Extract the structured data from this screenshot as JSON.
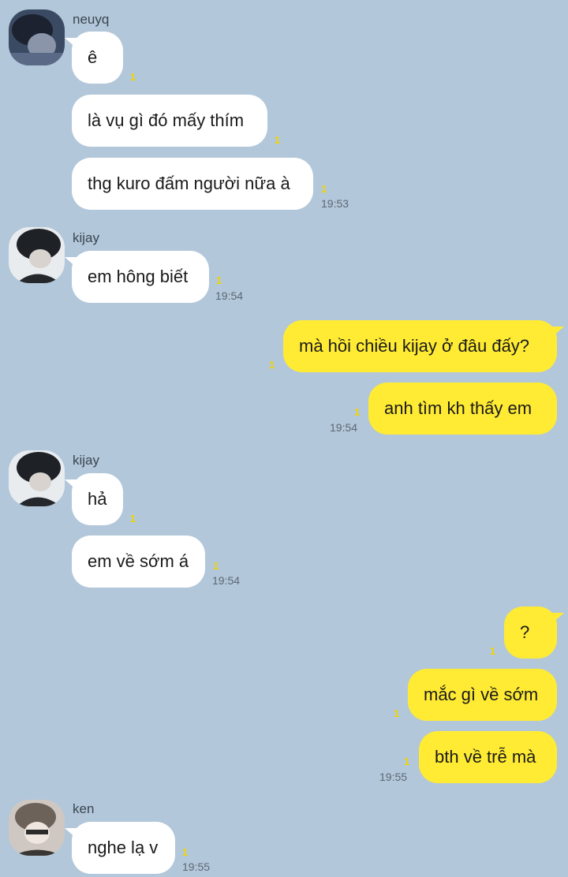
{
  "theme": {
    "background": "#b2c7da",
    "incoming_bubble": "#ffffff",
    "outgoing_bubble": "#ffeb33",
    "unread_color": "#f2d400"
  },
  "messages": [
    {
      "sender": "neuyq",
      "text": "ê",
      "unread": "1"
    },
    {
      "text": "là vụ gì đó mấy thím",
      "unread": "1"
    },
    {
      "text": "thg kuro đấm người nữa à",
      "unread": "1",
      "time": "19:53"
    },
    {
      "sender": "kijay",
      "text": "em hông biết",
      "unread": "1",
      "time": "19:54"
    },
    {
      "text": "mà hồi chiều kijay ở đâu đấy?",
      "unread": "1"
    },
    {
      "text": "anh tìm kh thấy em",
      "unread": "1",
      "time": "19:54"
    },
    {
      "sender": "kijay",
      "text": "hả",
      "unread": "1"
    },
    {
      "text": "em về sớm á",
      "unread": "1",
      "time": "19:54"
    },
    {
      "text": "?",
      "unread": "1"
    },
    {
      "text": "mắc gì về sớm",
      "unread": "1"
    },
    {
      "text": "bth về trễ mà",
      "unread": "1",
      "time": "19:55"
    },
    {
      "sender": "ken",
      "text": "nghe lạ v",
      "unread": "1",
      "time": "19:55"
    }
  ]
}
